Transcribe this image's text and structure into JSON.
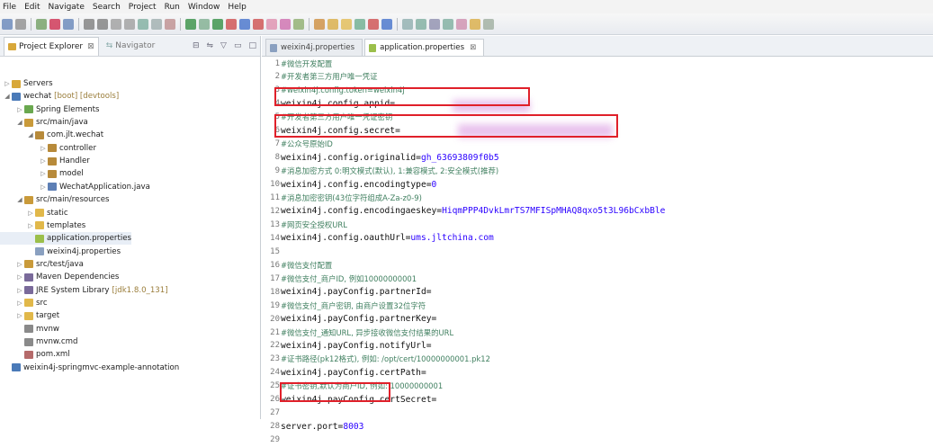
{
  "menu": [
    "File",
    "Edit",
    "Navigate",
    "Search",
    "Project",
    "Run",
    "Window",
    "Help"
  ],
  "left_tabs": {
    "explorer": "Project Explorer",
    "navigator": "Navigator"
  },
  "tree": [
    {
      "label": "Servers",
      "tw": "▷",
      "icon": "#d8a83a",
      "level": 0
    },
    {
      "label": "wechat",
      "deco": "[boot] [devtools]",
      "tw": "◢",
      "icon": "#4a7ab8",
      "level": 0
    },
    {
      "label": "Spring Elements",
      "tw": "▷",
      "icon": "#6aa84f",
      "level": 1
    },
    {
      "label": "src/main/java",
      "tw": "◢",
      "icon": "#c99a3a",
      "level": 1
    },
    {
      "label": "com.jlt.wechat",
      "tw": "◢",
      "icon": "#b78a3a",
      "level": 2
    },
    {
      "label": "controller",
      "tw": "▷",
      "icon": "#b78a3a",
      "level": 3
    },
    {
      "label": "Handler",
      "tw": "▷",
      "icon": "#b78a3a",
      "level": 3
    },
    {
      "label": "model",
      "tw": "▷",
      "icon": "#b78a3a",
      "level": 3
    },
    {
      "label": "WechatApplication.java",
      "tw": "▷",
      "icon": "#5d7fb5",
      "level": 3
    },
    {
      "label": "src/main/resources",
      "tw": "◢",
      "icon": "#c99a3a",
      "level": 1
    },
    {
      "label": "static",
      "tw": "▷",
      "icon": "#e1b84a",
      "level": 2
    },
    {
      "label": "templates",
      "tw": "▷",
      "icon": "#e1b84a",
      "level": 2
    },
    {
      "label": "application.properties",
      "tw": "",
      "icon": "#9bbf4a",
      "level": 2,
      "selected": true
    },
    {
      "label": "weixin4j.properties",
      "tw": "",
      "icon": "#8aa0c0",
      "level": 2
    },
    {
      "label": "src/test/java",
      "tw": "▷",
      "icon": "#c99a3a",
      "level": 1
    },
    {
      "label": "Maven Dependencies",
      "tw": "▷",
      "icon": "#7a6a9a",
      "level": 1
    },
    {
      "label": "JRE System Library",
      "deco": "[jdk1.8.0_131]",
      "tw": "▷",
      "icon": "#7a6a9a",
      "level": 1
    },
    {
      "label": "src",
      "tw": "▷",
      "icon": "#e1b84a",
      "level": 1
    },
    {
      "label": "target",
      "tw": "▷",
      "icon": "#e1b84a",
      "level": 1
    },
    {
      "label": "mvnw",
      "tw": "",
      "icon": "#8a8a8a",
      "level": 1
    },
    {
      "label": "mvnw.cmd",
      "tw": "",
      "icon": "#8a8a8a",
      "level": 1
    },
    {
      "label": "pom.xml",
      "tw": "",
      "icon": "#b56a6a",
      "level": 1
    },
    {
      "label": "weixin4j-springmvc-example-annotation",
      "tw": "",
      "icon": "#4a7ab8",
      "level": 0
    }
  ],
  "editor_tabs": [
    {
      "label": "weixin4j.properties",
      "active": false
    },
    {
      "label": "application.properties",
      "active": true
    }
  ],
  "lines": [
    {
      "n": "1",
      "c": "#微信开发配置"
    },
    {
      "n": "2",
      "c": "#开发者第三方用户唯一凭证"
    },
    {
      "n": "3",
      "c": "#weixin4j.config.token=weixin4j"
    },
    {
      "n": "4",
      "k": "weixin4j.config.appid="
    },
    {
      "n": "5",
      "c": "#开发者第三方用户唯一凭证密钥"
    },
    {
      "n": "6",
      "k": "weixin4j.config.secret="
    },
    {
      "n": "7",
      "c": "#公众号原始ID"
    },
    {
      "n": "8",
      "k": "weixin4j.config.originalid=",
      "v": "gh_63693809f0b5"
    },
    {
      "n": "9",
      "c": "#消息加密方式 0:明文模式(默认), 1:兼容模式, 2:安全模式(推荐)"
    },
    {
      "n": "10",
      "k": "weixin4j.config.encodingtype=",
      "v": "0"
    },
    {
      "n": "11",
      "c": "#消息加密密钥(43位字符组成A-Za-z0-9)"
    },
    {
      "n": "12",
      "k": "weixin4j.config.encodingaeskey=",
      "v": "HiqmPPP4DvkLmrTS7MFISpMHAQ8qxo5t3L96bCxbBle"
    },
    {
      "n": "13",
      "c": "#网页安全授权URL"
    },
    {
      "n": "14",
      "k": "weixin4j.config.oauthUrl=",
      "v": "ums.jltchina.com"
    },
    {
      "n": "15"
    },
    {
      "n": "16",
      "c": "#微信支付配置"
    },
    {
      "n": "17",
      "c": "#微信支付_商户ID, 例如10000000001"
    },
    {
      "n": "18",
      "k": "weixin4j.payConfig.partnerId="
    },
    {
      "n": "19",
      "c": "#微信支付_商户密钥, 由商户设置32位字符"
    },
    {
      "n": "20",
      "k": "weixin4j.payConfig.partnerKey="
    },
    {
      "n": "21",
      "c": "#微信支付_通知URL, 异步接收微信支付结果的URL"
    },
    {
      "n": "22",
      "k": "weixin4j.payConfig.notifyUrl="
    },
    {
      "n": "23",
      "c": "#证书路径(pk12格式), 例如: /opt/cert/10000000001.pk12"
    },
    {
      "n": "24",
      "k": "weixin4j.payConfig.certPath="
    },
    {
      "n": "25",
      "c": "#证书密钥,默认为商户ID, 例如: 10000000001"
    },
    {
      "n": "26",
      "k": "weixin4j.payConfig.certSecret="
    },
    {
      "n": "27"
    },
    {
      "n": "28",
      "k": "server.port=",
      "v": "8003"
    },
    {
      "n": "29"
    }
  ],
  "colors": {
    "highlight": "#e0202a",
    "comment": "#3f7f5f",
    "value": "#2a00ff"
  }
}
